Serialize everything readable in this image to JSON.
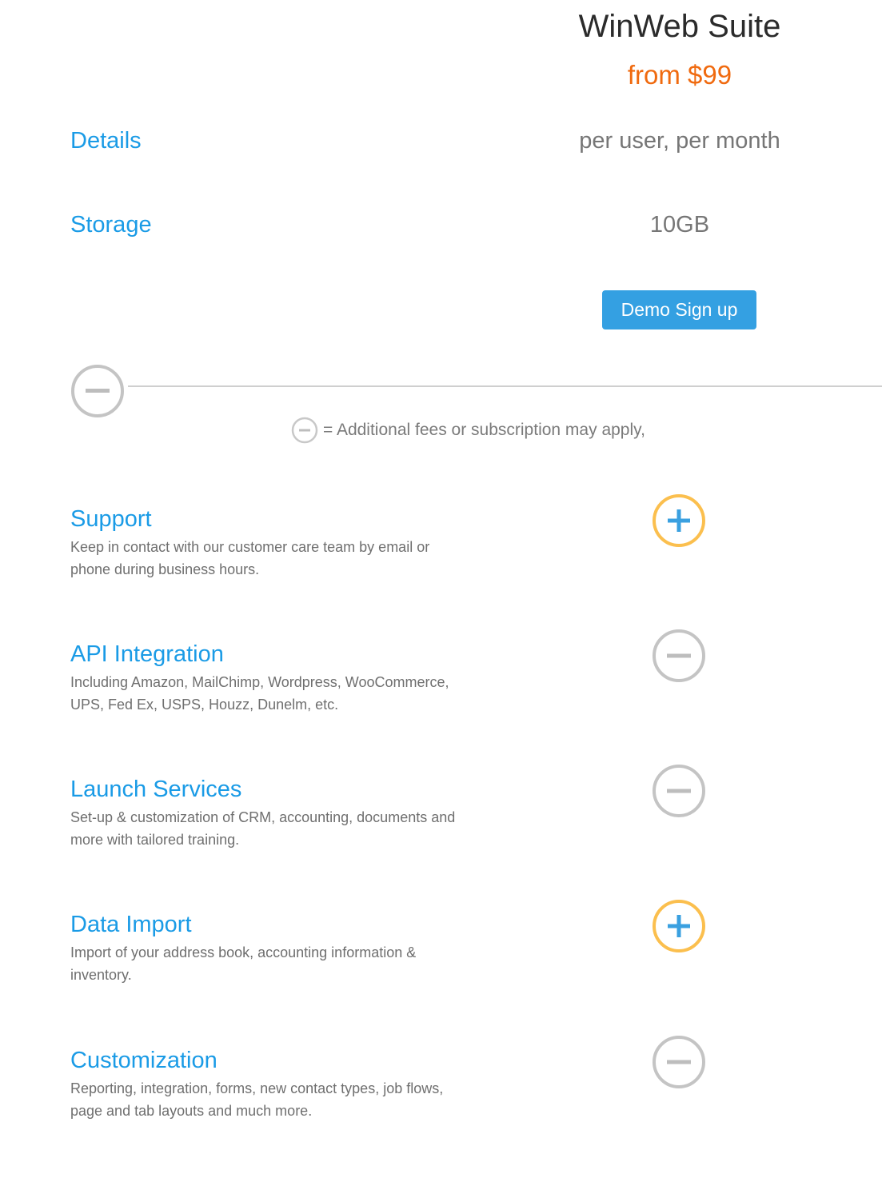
{
  "plan": {
    "name": "WinWeb Suite",
    "price": "from $99",
    "accent_color": "#f06a0f"
  },
  "rows": [
    {
      "label": "Details",
      "value": "per user, per month"
    },
    {
      "label": "Storage",
      "value": "10GB"
    }
  ],
  "cta": {
    "label": "Demo Sign up",
    "color": "#34a0e2"
  },
  "legend": {
    "icon": "minus-circle-icon",
    "text": "= Additional fees or subscription may apply,"
  },
  "features": [
    {
      "title": "Support",
      "desc_line1": "Keep in contact with our customer care team by email or",
      "desc_line2": "phone during business hours.",
      "status": "included",
      "icon": "plus-circle-icon"
    },
    {
      "title": "API Integration",
      "desc_line1": "Including Amazon, MailChimp, Wordpress, WooCommerce,",
      "desc_line2": "UPS, Fed Ex, USPS, Houzz, Dunelm, etc.",
      "status": "additional-fees",
      "icon": "minus-circle-icon"
    },
    {
      "title": "Launch Services",
      "desc_line1": "Set-up & customization of CRM, accounting, documents and",
      "desc_line2": "more with tailored training.",
      "status": "additional-fees",
      "icon": "minus-circle-icon"
    },
    {
      "title": "Data Import",
      "desc_line1": "Import of your address book, accounting information &",
      "desc_line2": "inventory.",
      "status": "included",
      "icon": "plus-circle-icon"
    },
    {
      "title": "Customization",
      "desc_line1": "Reporting, integration, forms, new contact types, job flows,",
      "desc_line2": "page and tab layouts and much more.",
      "status": "additional-fees",
      "icon": "minus-circle-icon"
    }
  ],
  "colors": {
    "link_blue": "#1a9be6",
    "included_ring": "#fbbf4e",
    "included_plus": "#3aa0e0",
    "fees_gray": "#bdbdbd"
  }
}
